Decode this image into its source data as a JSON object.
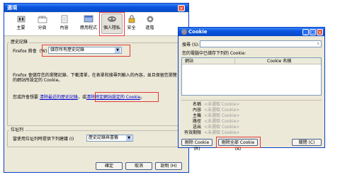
{
  "options": {
    "title": "選項",
    "toolbar": [
      "主要",
      "分頁",
      "內容",
      "應用程式",
      "個人隱私",
      "安全",
      "進階"
    ],
    "history": {
      "group_title": "歷史記錄",
      "prefix": "Firefox 將會",
      "underline": "(W)",
      "select_value": "儲存所有歷史記錄",
      "desc": "Firefox 會儲存您的瀏覽記錄、下載清單，在表單和搜尋列輸入的內容，並且保留您瀏覽的網站所設定的 Cookie。",
      "you_may": "您或許會想要",
      "link1": "清除最近的歷史記錄",
      "or": "，或",
      "link2": "清除特定網站設定的 Cookie",
      "end": "。"
    },
    "urlbar": {
      "group_title": "位址列",
      "label": "當使用位址列時提供下列建議 (I)",
      "select_value": "歷史記錄與書籤"
    },
    "buttons": {
      "ok": "確定",
      "cancel": "取消",
      "help": "說明 (H)"
    }
  },
  "cookie": {
    "title": "Cookie",
    "search_label": "搜尋 (S):",
    "stored_label": "您的電腦中已儲存下列的 Cookie:",
    "col_site": "網站",
    "col_name": "Cookie 名稱",
    "details": [
      {
        "label": "名稱",
        "value": "<未選取 Cookie>"
      },
      {
        "label": "內容",
        "value": "<未選取 Cookie>"
      },
      {
        "label": "主機",
        "value": "<未選取 Cookie>"
      },
      {
        "label": "路徑",
        "value": "<未選取 Cookie>"
      },
      {
        "label": "送出",
        "value": "<未選取 Cookie>"
      },
      {
        "label": "有效期限",
        "value": "<未選取 Cookie>"
      }
    ],
    "btn_remove": "刪除 Cookie (R)",
    "btn_remove_all": "刪除全部 Cookie (A)",
    "btn_close": "關閉 (C)"
  }
}
